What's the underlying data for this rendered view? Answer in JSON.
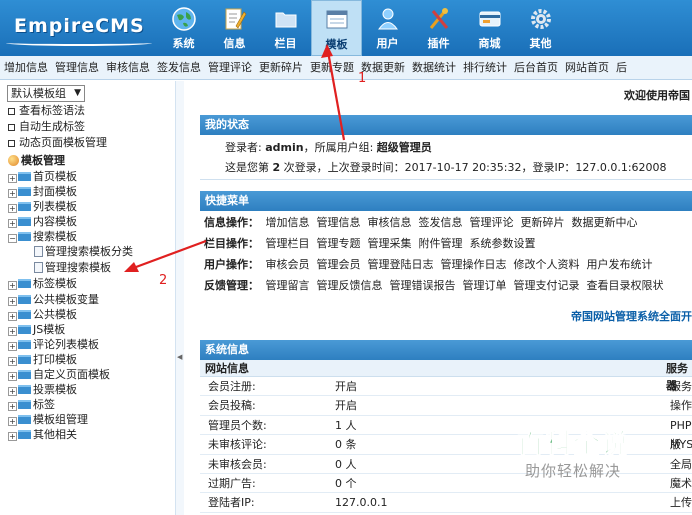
{
  "app": {
    "logo_text": "EmpireCMS"
  },
  "nav": {
    "items": [
      {
        "label": "系统",
        "icon": "globe-icon"
      },
      {
        "label": "信息",
        "icon": "edit-document-icon"
      },
      {
        "label": "栏目",
        "icon": "folder-icon"
      },
      {
        "label": "模板",
        "icon": "template-window-icon"
      },
      {
        "label": "用户",
        "icon": "user-icon"
      },
      {
        "label": "插件",
        "icon": "tools-icon"
      },
      {
        "label": "商城",
        "icon": "shop-card-icon"
      },
      {
        "label": "其他",
        "icon": "gear-icon"
      }
    ],
    "active": "模板"
  },
  "menubar": {
    "items": [
      "增加信息",
      "管理信息",
      "审核信息",
      "签发信息",
      "管理评论",
      "更新碎片",
      "更新专题",
      "数据更新",
      "数据统计",
      "排行统计",
      "后台首页",
      "网站首页",
      "后"
    ]
  },
  "left": {
    "template_group": "默认模板组",
    "links": [
      "查看标签语法",
      "自动生成标签",
      "动态页面模板管理"
    ],
    "group_title": "模板管理",
    "tree": [
      {
        "label": "首页模板"
      },
      {
        "label": "封面模板"
      },
      {
        "label": "列表模板"
      },
      {
        "label": "内容模板"
      },
      {
        "label": "搜索模板",
        "expanded": true,
        "children": [
          "管理搜索模板分类",
          "管理搜索模板"
        ]
      },
      {
        "label": "标签模板"
      },
      {
        "label": "公共模板变量"
      },
      {
        "label": "公共模板"
      },
      {
        "label": "JS模板"
      },
      {
        "label": "评论列表模板"
      },
      {
        "label": "打印模板"
      },
      {
        "label": "自定义页面模板"
      },
      {
        "label": "投票模板"
      },
      {
        "label": "标签"
      },
      {
        "label": "模板组管理"
      },
      {
        "label": "其他相关"
      }
    ]
  },
  "main": {
    "welcome": "欢迎使用帝国",
    "status": {
      "title": "我的状态",
      "login_prefix": "登录者: ",
      "username": "admin",
      "group_prefix": "，所属用户组: ",
      "group": "超级管理员",
      "line2_a": "这是您第 ",
      "login_count": "2",
      "line2_b": " 次登录，上次登录时间：",
      "last_login_time": "2017-10-17 20:35:32",
      "line2_c": "，登录IP：",
      "last_login_ip": "127.0.0.1:62008"
    },
    "quick": {
      "title": "快捷菜单",
      "rows": [
        {
          "label": "信息操作：",
          "links": [
            "增加信息",
            "管理信息",
            "审核信息",
            "签发信息",
            "管理评论",
            "更新碎片",
            "数据更新中心"
          ]
        },
        {
          "label": "栏目操作：",
          "links": [
            "管理栏目",
            "管理专题",
            "管理采集",
            "附件管理",
            "系统参数设置"
          ]
        },
        {
          "label": "用户操作：",
          "links": [
            "审核会员",
            "管理会员",
            "管理登陆日志",
            "管理操作日志",
            "修改个人资料",
            "用户发布统计"
          ]
        },
        {
          "label": "反馈管理：",
          "links": [
            "管理留言",
            "管理反馈信息",
            "管理错误报告",
            "管理订单",
            "管理支付记录",
            "查看目录权限状"
          ]
        }
      ],
      "banner": "帝国网站管理系统全面开"
    },
    "system": {
      "title": "系统信息",
      "col1": "网站信息",
      "col2": "服务器",
      "rows": [
        {
          "k": "会员注册:",
          "v": "开启",
          "k2": "服务"
        },
        {
          "k": "会员投稿:",
          "v": "开启",
          "k2": "操作"
        },
        {
          "k": "管理员个数:",
          "v": "1 人",
          "k2": "PHP版"
        },
        {
          "k": "未审核评论:",
          "v": "0 条",
          "k2": "MYSQ"
        },
        {
          "k": "未审核会员:",
          "v": "0 人",
          "k2": "全局"
        },
        {
          "k": "过期广告:",
          "v": "0 个",
          "k2": "魔术"
        },
        {
          "k": "登陆者IP:",
          "v": "127.0.0.1",
          "k2": "上传"
        }
      ]
    }
  },
  "annotations": {
    "label_1": "1",
    "label_2": "2",
    "color": "#e02020"
  },
  "watermark": {
    "main": "百科全说",
    "sub": "助你轻松解决"
  },
  "colors": {
    "header_blue": "#1f7bc4",
    "panel_blue": "#3a8ccc",
    "link_blue": "#0b5fa8",
    "watermark_green": "#3ba55c"
  }
}
